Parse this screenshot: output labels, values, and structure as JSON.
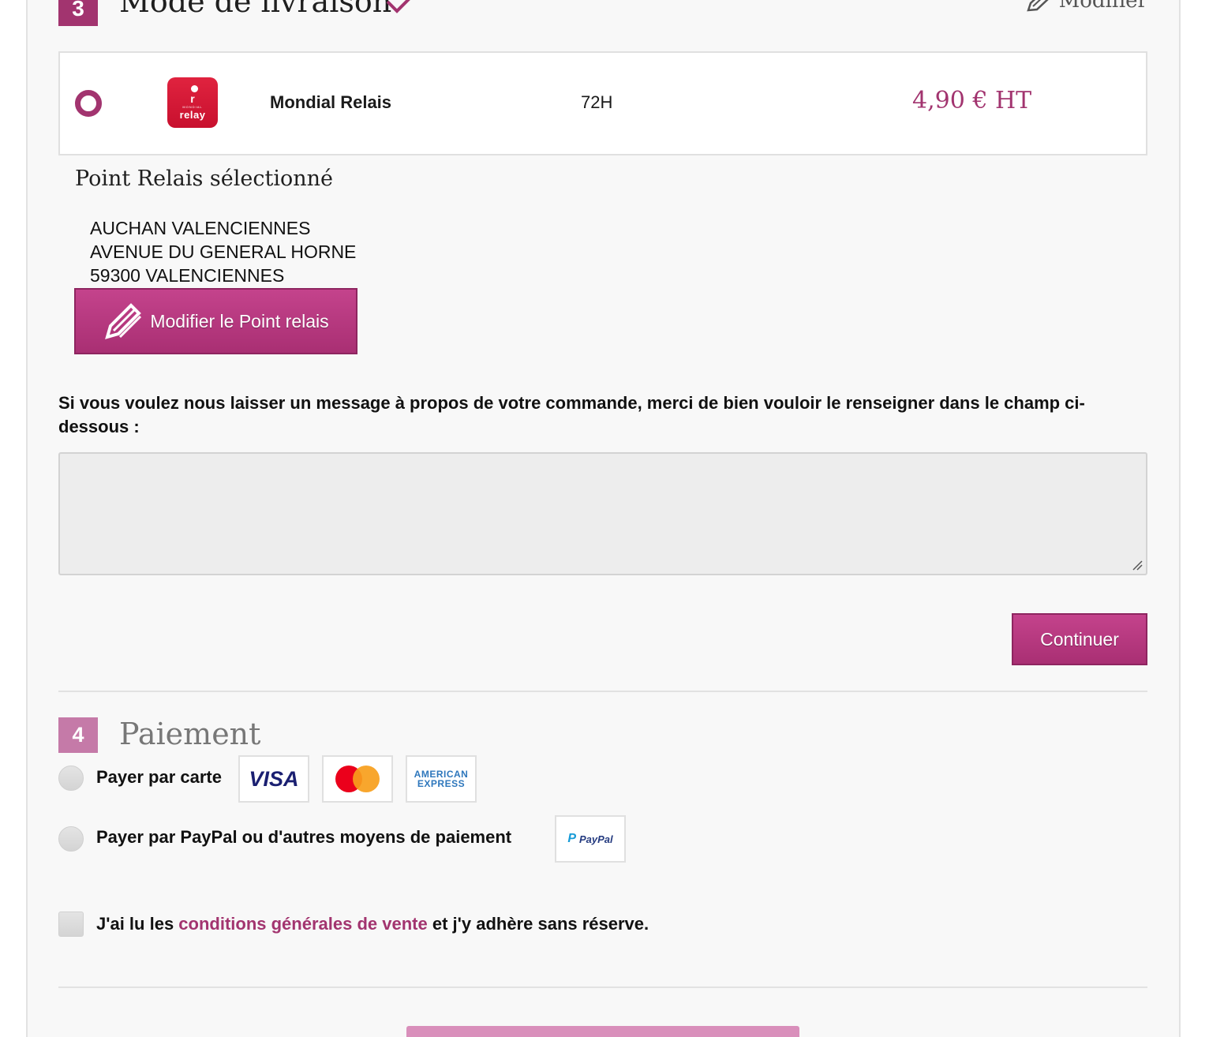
{
  "step3": {
    "number": "3",
    "title": "Mode de livraison",
    "edit_label": "Modifier"
  },
  "carrier": {
    "logo_small": "MONDIAL",
    "logo_big": "relay",
    "name": "Mondial Relais",
    "delay": "72H",
    "price": "4,90 € HT"
  },
  "relay": {
    "heading": "Point Relais sélectionné",
    "address_line1": "AUCHAN VALENCIENNES",
    "address_line2": "AVENUE DU GENERAL HORNE",
    "address_line3": "59300 VALENCIENNES",
    "modify_button": "Modifier le Point relais"
  },
  "message": {
    "label": "Si vous voulez nous laisser un message à propos de votre commande, merci de bien vouloir le renseigner dans le champ ci-dessous :",
    "value": ""
  },
  "continue_button": "Continuer",
  "step4": {
    "number": "4",
    "title": "Paiement",
    "card_option": "Payer par carte",
    "paypal_option": "Payer par PayPal ou d'autres moyens de paiement",
    "visa": "VISA",
    "amex_line1": "AMERICAN",
    "amex_line2": "EXPRESS",
    "paypal_logo": "PayPal"
  },
  "terms": {
    "prefix": "J'ai lu les ",
    "link": "conditions générales de vente",
    "suffix": " et j'y adhère sans réserve."
  },
  "colors": {
    "accent": "#a2346f",
    "accent_light": "#c57aa8"
  }
}
